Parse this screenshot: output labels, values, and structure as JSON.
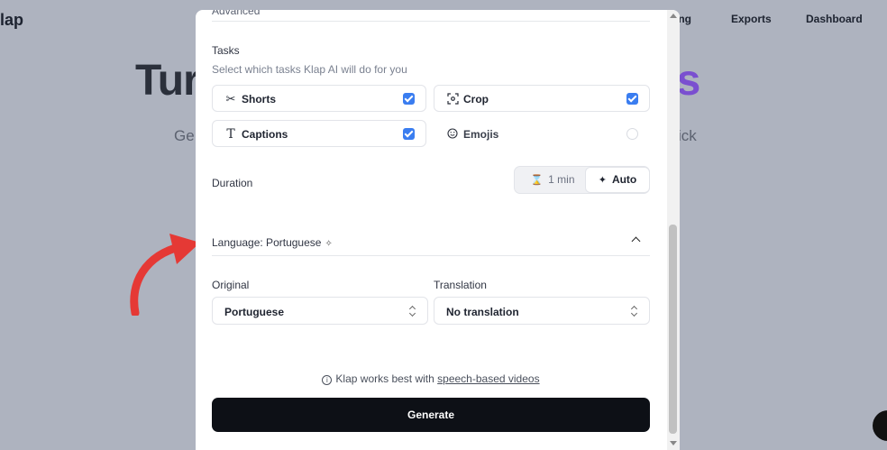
{
  "background": {
    "logo_text": "lap",
    "nav": [
      "ing",
      "Exports",
      "Dashboard"
    ],
    "hero_left": "Tur",
    "hero_right": "rts",
    "sub_left": "Ge",
    "sub_right": "ick"
  },
  "modal": {
    "advanced_label": "Advanced",
    "tasks": {
      "title": "Tasks",
      "subtitle": "Select which tasks Klap AI will do for you",
      "items": [
        {
          "label": "Shorts",
          "icon": "scissors-icon",
          "checked": true
        },
        {
          "label": "Crop",
          "icon": "crop-focus-icon",
          "checked": true
        },
        {
          "label": "Captions",
          "icon": "text-t-icon",
          "checked": true
        },
        {
          "label": "Emojis",
          "icon": "smiley-icon",
          "checked": false
        }
      ]
    },
    "duration": {
      "label": "Duration",
      "options": [
        "1 min",
        "Auto"
      ],
      "selected": "Auto"
    },
    "language": {
      "header": "Language: Portuguese",
      "original_label": "Original",
      "original_value": "Portuguese",
      "translation_label": "Translation",
      "translation_value": "No translation"
    },
    "info": {
      "text": "Klap works best with",
      "link": "speech-based videos"
    },
    "generate_label": "Generate"
  },
  "colors": {
    "accent": "#3a7df0",
    "button_dark": "#0d1016",
    "hero_purple": "#7a4fd0",
    "arrow_red": "#e53935"
  }
}
